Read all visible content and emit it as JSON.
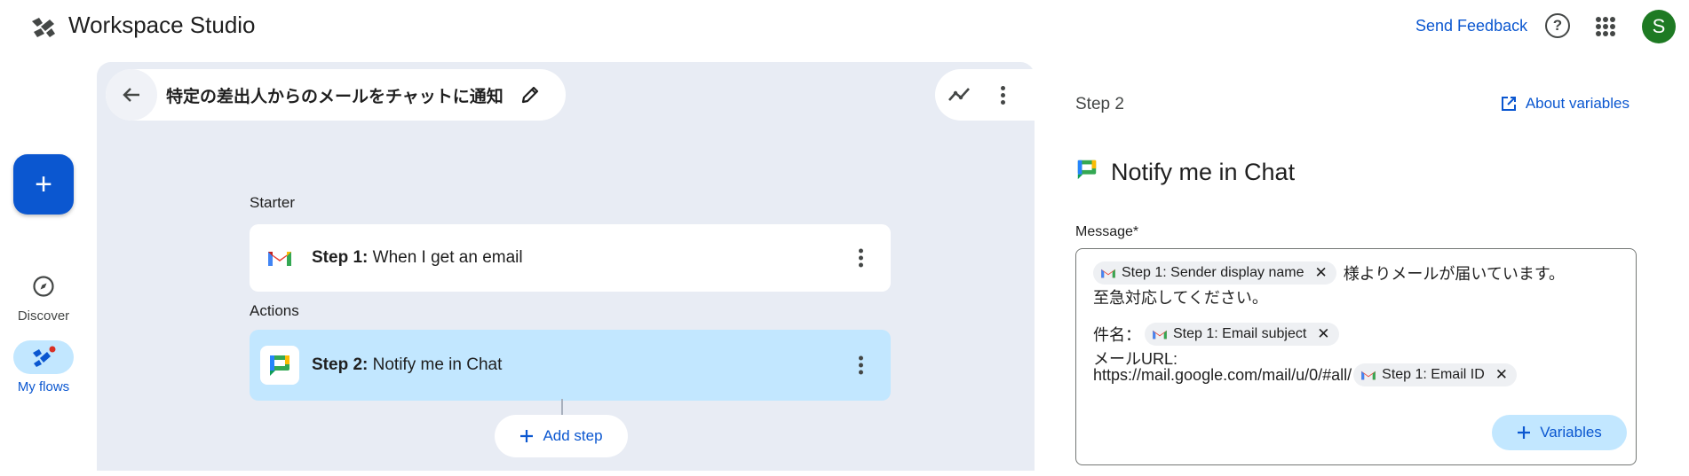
{
  "app": {
    "title": "Workspace Studio"
  },
  "header": {
    "feedback_label": "Send Feedback",
    "help_glyph": "?",
    "avatar_initial": "S"
  },
  "rail": {
    "create_glyph": "+",
    "items": [
      {
        "label": "Discover",
        "icon": "compass-icon",
        "active": false
      },
      {
        "label": "My flows",
        "icon": "flows-icon",
        "active": true
      }
    ]
  },
  "flow": {
    "title": "特定の差出人からのメールをチャットに通知"
  },
  "canvas": {
    "starter_label": "Starter",
    "actions_label": "Actions",
    "steps": [
      {
        "prefix": "Step 1:",
        "text": "When I get an email",
        "icon": "gmail-icon"
      },
      {
        "prefix": "Step 2:",
        "text": "Notify me in Chat",
        "icon": "chat-icon",
        "selected": true
      }
    ],
    "add_step_label": "Add step"
  },
  "panel": {
    "step_label": "Step 2",
    "about_label": "About variables",
    "title": "Notify me in Chat",
    "message_label": "Message*",
    "message": {
      "chip_sender": "Step 1: Sender display name",
      "text_after_sender": "様よりメールが届いています。",
      "line2": "至急対応してください。",
      "subject_prefix": "件名：",
      "chip_subject": "Step 1: Email subject",
      "url_label": "メールURL:",
      "url_text": "https://mail.google.com/mail/u/0/#all/",
      "chip_id": "Step 1: Email ID",
      "close_glyph": "✕"
    },
    "variables_label": "Variables"
  },
  "colors": {
    "accent": "#0b57d0",
    "canvas": "#e8ecf4",
    "selected": "#c2e7ff",
    "avatar": "#1e7a23"
  }
}
